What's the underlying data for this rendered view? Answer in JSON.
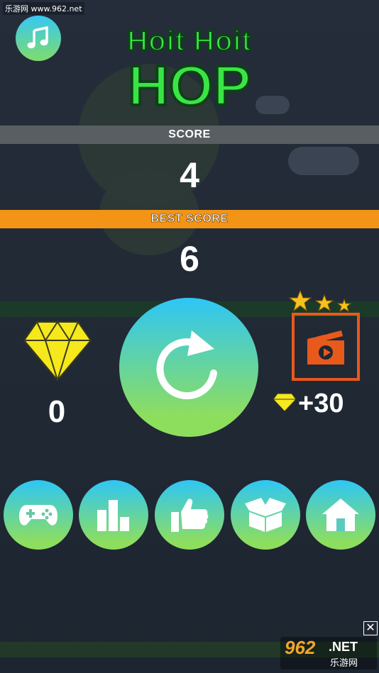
{
  "watermark": "乐游网 www.962.net",
  "title": {
    "line1": "Hoit Hoit",
    "line2": "HOP"
  },
  "score": {
    "label": "SCORE",
    "value": "4"
  },
  "best_score": {
    "label": "BEST SCORE",
    "value": "6"
  },
  "gems": {
    "count": "0",
    "icon": "diamond-icon",
    "color": "#f5e81c"
  },
  "reward": {
    "value": "+30",
    "stars": 3,
    "icon": "video-clapper-icon"
  },
  "buttons": {
    "music": "music-note-icon",
    "replay": "replay-icon",
    "menu": [
      "gamepad-icon",
      "leaderboard-icon",
      "thumbs-up-icon",
      "box-icon",
      "home-icon"
    ]
  },
  "ad": {
    "close": "✕",
    "logo_num": "962",
    "logo_net": ".NET",
    "logo_cn": "乐游网"
  },
  "colors": {
    "title_green": "#39e545",
    "best_orange": "#f39416",
    "score_gray": "#595e63",
    "video_orange": "#e8591c"
  }
}
